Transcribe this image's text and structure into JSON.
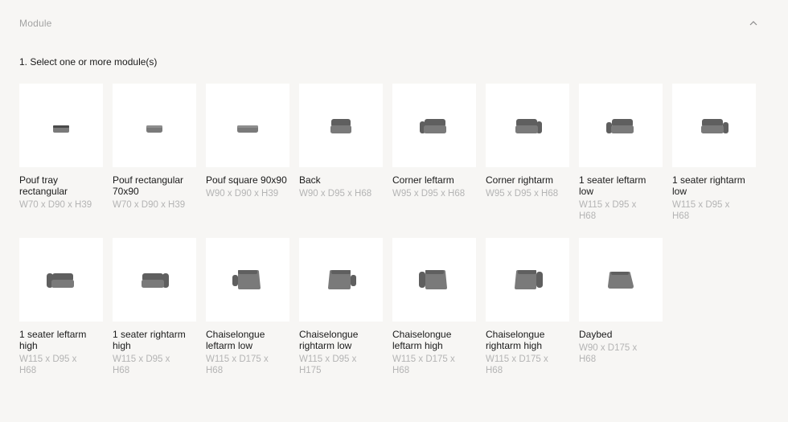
{
  "section": {
    "title": "Module",
    "collapse_icon": "chevron-up-icon"
  },
  "step_label": "1. Select one or more module(s)",
  "modules": [
    {
      "name": "Pouf tray rectangular",
      "dims": "W70 x D90 x H39",
      "icon": "pouf-tray-rectangular"
    },
    {
      "name": "Pouf rectangular 70x90",
      "dims": "W70 x D90 x H39",
      "icon": "pouf-rectangular"
    },
    {
      "name": "Pouf square 90x90",
      "dims": "W90 x D90 x H39",
      "icon": "pouf-square"
    },
    {
      "name": "Back",
      "dims": "W90 x D95 x H68",
      "icon": "back"
    },
    {
      "name": "Corner leftarm",
      "dims": "W95 x D95 x H68",
      "icon": "corner-leftarm"
    },
    {
      "name": "Corner rightarm",
      "dims": "W95 x D95 x H68",
      "icon": "corner-rightarm"
    },
    {
      "name": "1 seater leftarm low",
      "dims": "W115 x D95 x H68",
      "icon": "seater-leftarm-low"
    },
    {
      "name": "1 seater rightarm low",
      "dims": "W115 x D95 x H68",
      "icon": "seater-rightarm-low"
    },
    {
      "name": "1 seater leftarm high",
      "dims": "W115 x D95 x H68",
      "icon": "seater-leftarm-high"
    },
    {
      "name": "1 seater rightarm high",
      "dims": "W115 x D95 x H68",
      "icon": "seater-rightarm-high"
    },
    {
      "name": "Chaiselongue leftarm low",
      "dims": "W115 x D175 x H68",
      "icon": "chaise-leftarm-low"
    },
    {
      "name": "Chaiselongue rightarm low",
      "dims": "W115 x D95 x H175",
      "icon": "chaise-rightarm-low"
    },
    {
      "name": "Chaiselongue leftarm high",
      "dims": "W115 x D175 x H68",
      "icon": "chaise-leftarm-high"
    },
    {
      "name": "Chaiselongue rightarm high",
      "dims": "W115 x D175 x H68",
      "icon": "chaise-rightarm-high"
    },
    {
      "name": "Daybed",
      "dims": "W90 x D175 x H68",
      "icon": "daybed"
    }
  ]
}
